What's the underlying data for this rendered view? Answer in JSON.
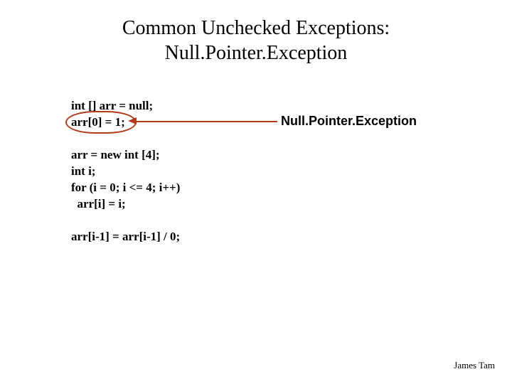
{
  "title_line1": "Common Unchecked Exceptions:",
  "title_line2": "Null.Pointer.Exception",
  "code": {
    "l1": "int [] arr = null;",
    "l2": "arr[0] = 1;",
    "gap1": " ",
    "l3": "arr = new int [4];",
    "l4": "int i;",
    "l5": "for (i = 0; i <= 4; i++)",
    "l6": "  arr[i] = i;",
    "gap2": " ",
    "l7": "arr[i-1] = arr[i-1] / 0;"
  },
  "callout": "Null.Pointer.Exception",
  "footer": "James Tam"
}
